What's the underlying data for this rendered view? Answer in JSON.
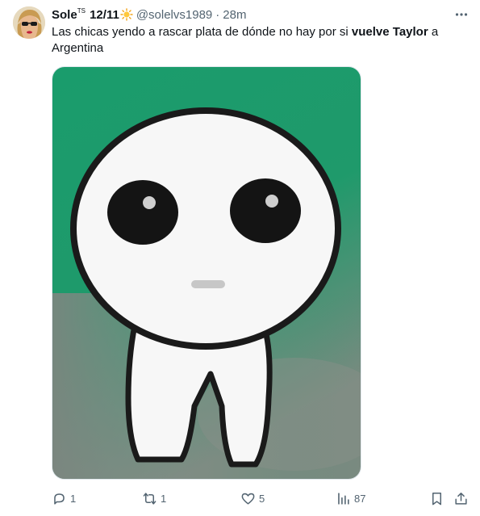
{
  "tweet": {
    "author": {
      "name": "Sole",
      "superscript": "TS",
      "name_suffix": "12/11",
      "handle": "@solelvs1989",
      "separator": "·",
      "time": "28m"
    },
    "text": {
      "part1": "Las chicas yendo a rascar plata de dónde no hay por si ",
      "bold": "vuelve Taylor",
      "part2": " a Argentina"
    },
    "media": {
      "description_icon": "cartoon-creature-image"
    },
    "actions": {
      "replies": "1",
      "reposts": "1",
      "likes": "5",
      "views": "87"
    }
  },
  "colors": {
    "secondary_text": "#536471",
    "primary_text": "#0f1419",
    "media_green": "#1c9a6e"
  }
}
